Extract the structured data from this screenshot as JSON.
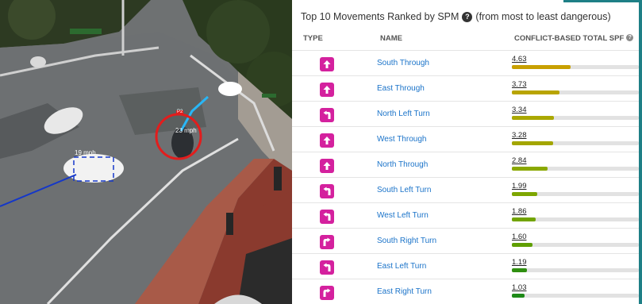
{
  "panel": {
    "title": "Top 10 Movements Ranked by SPM",
    "title_suffix": "(from most to least dangerous)",
    "help_glyph": "?",
    "columns": {
      "type": "TYPE",
      "name": "NAME",
      "spf": "CONFLICT-BASED TOTAL SPF"
    }
  },
  "camera": {
    "labels": {
      "speed_main": "19 mph",
      "speed_side": "23 mph",
      "tag": "P2"
    }
  },
  "spf_scale_max": 10,
  "movements": [
    {
      "name": "South Through",
      "type_icon": "arrow-up-icon",
      "spf": "4.63",
      "value": 4.63,
      "bar_color": "#c8a000"
    },
    {
      "name": "East Through",
      "type_icon": "arrow-up-icon",
      "spf": "3.73",
      "value": 3.73,
      "bar_color": "#b8a400"
    },
    {
      "name": "North Left Turn",
      "type_icon": "arrow-turn-left-icon",
      "spf": "3.34",
      "value": 3.34,
      "bar_color": "#aaa800"
    },
    {
      "name": "West Through",
      "type_icon": "arrow-up-icon",
      "spf": "3.28",
      "value": 3.28,
      "bar_color": "#a3a600"
    },
    {
      "name": "North Through",
      "type_icon": "arrow-up-icon",
      "spf": "2.84",
      "value": 2.84,
      "bar_color": "#8aa800"
    },
    {
      "name": "South Left Turn",
      "type_icon": "arrow-turn-left-icon",
      "spf": "1.99",
      "value": 1.99,
      "bar_color": "#7da600"
    },
    {
      "name": "West Left Turn",
      "type_icon": "arrow-turn-left-icon",
      "spf": "1.86",
      "value": 1.86,
      "bar_color": "#72a400"
    },
    {
      "name": "South Right Turn",
      "type_icon": "arrow-turn-right-icon",
      "spf": "1.60",
      "value": 1.6,
      "bar_color": "#5f9f00"
    },
    {
      "name": "East Left Turn",
      "type_icon": "arrow-turn-left-icon",
      "spf": "1.19",
      "value": 1.19,
      "bar_color": "#2f8f10"
    },
    {
      "name": "East Right Turn",
      "type_icon": "arrow-turn-right-icon",
      "spf": "1.03",
      "value": 1.03,
      "bar_color": "#1e8a18"
    }
  ]
}
